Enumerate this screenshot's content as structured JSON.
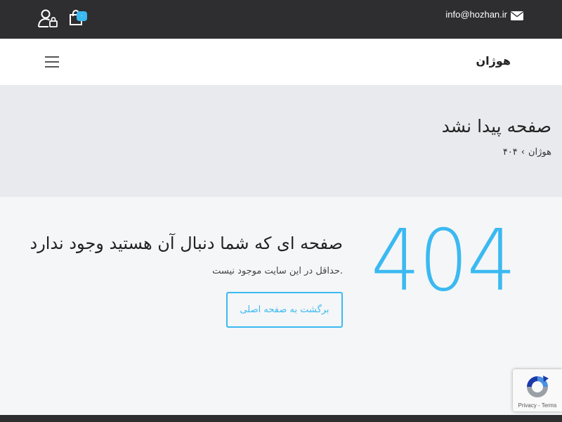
{
  "topbar": {
    "email": "info@hozhan.ir",
    "cart_count": "۰",
    "icons": [
      "mail-icon",
      "user-lock-icon",
      "shopping-bag-icon"
    ]
  },
  "navbar": {
    "brand": "هوژان",
    "menu_icon": "hamburger-icon"
  },
  "banner": {
    "title": "صفحه پیدا نشد",
    "breadcrumb": [
      "هوژان",
      "۴۰۴"
    ],
    "separator": "›"
  },
  "main": {
    "code": "404",
    "heading": "صفحه ای که شما دنبال آن هستید وجود ندارد",
    "subtext": "حداقل در این سایت موجود نیست.",
    "button_label": "برگشت به صفحه اصلی"
  },
  "recaptcha": {
    "terms": "Privacy - Terms"
  },
  "colors": {
    "accent": "#3bb9f1",
    "topbar_bg": "#2e2e31",
    "banner_bg": "#e8eaed",
    "page_bg": "#f5f6f8"
  }
}
